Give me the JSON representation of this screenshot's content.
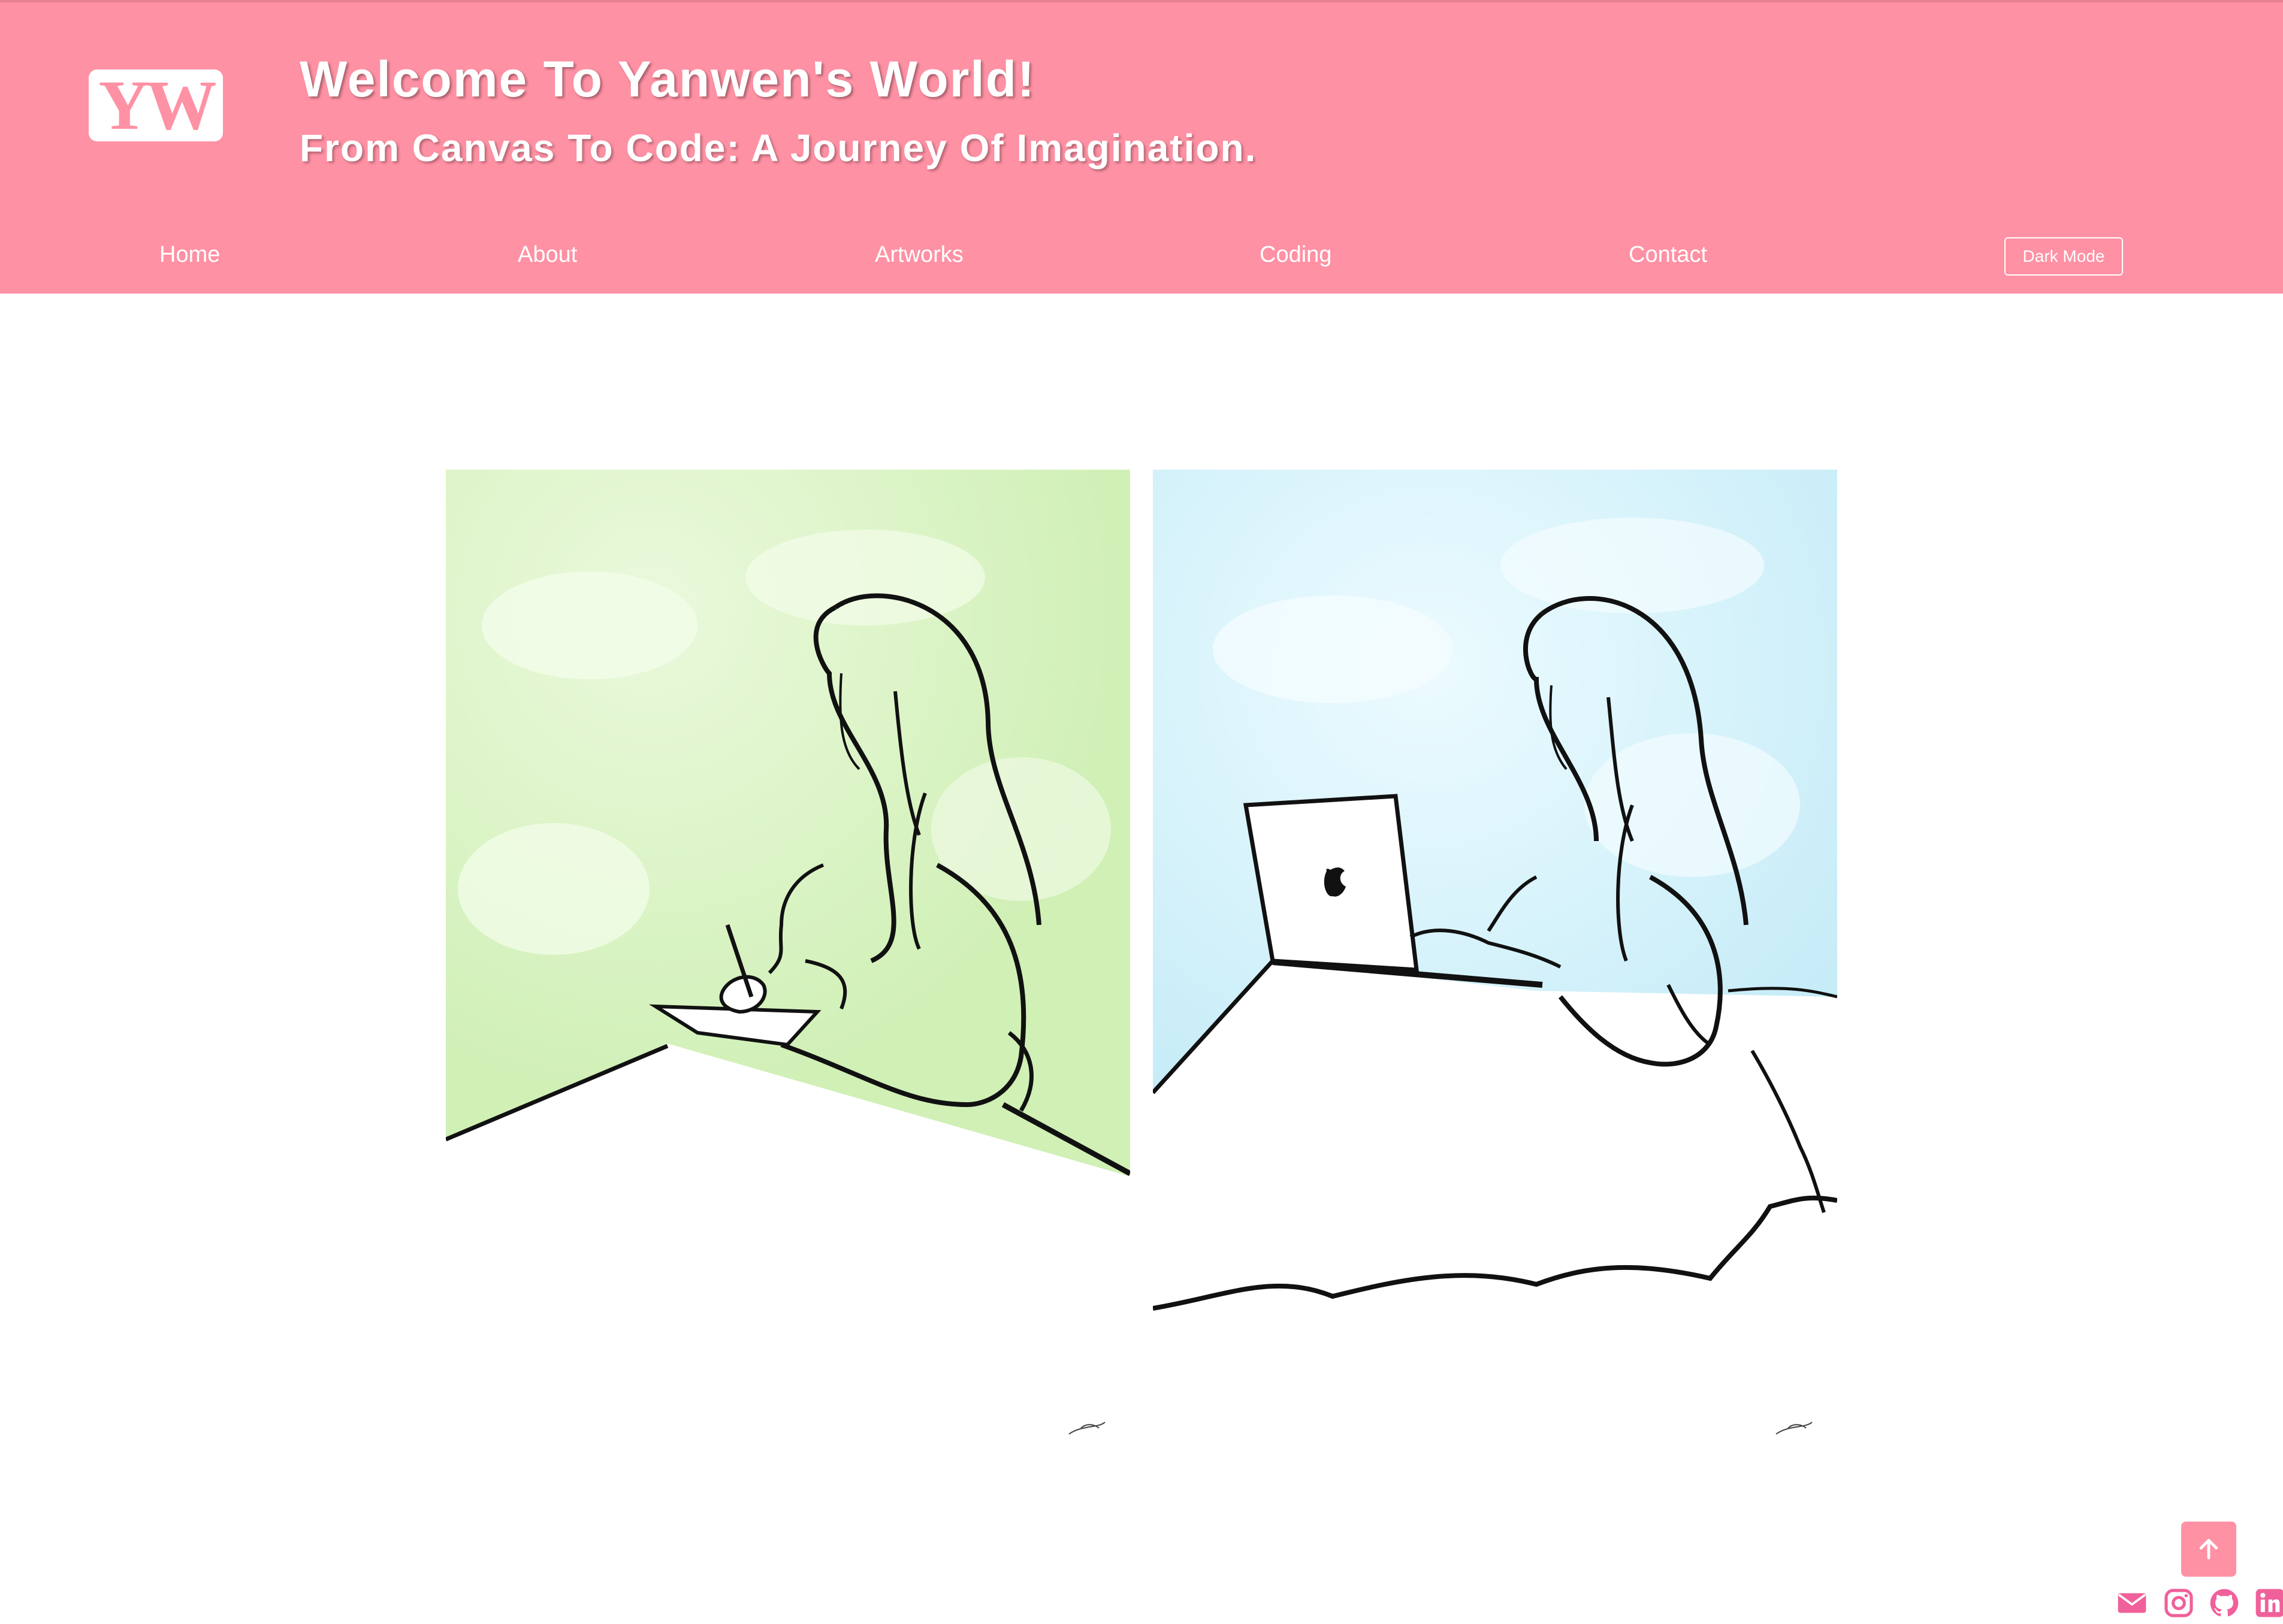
{
  "header": {
    "logo_text": "YW",
    "title": "Welcome To Yanwen's World!",
    "subtitle": "From Canvas To Code: A Journey Of Imagination."
  },
  "nav": {
    "items": [
      {
        "label": "Home"
      },
      {
        "label": "About"
      },
      {
        "label": "Artworks"
      },
      {
        "label": "Coding"
      },
      {
        "label": "Contact"
      }
    ],
    "dark_mode_label": "Dark Mode"
  },
  "artworks": [
    {
      "icon": "girl-drawing-on-tablet-illustration",
      "background": "#d8f4c4"
    },
    {
      "icon": "girl-using-laptop-illustration",
      "background": "#cdeffb"
    }
  ],
  "footer": {
    "back_to_top_icon": "arrow-up-icon",
    "social_icons": [
      "email-icon",
      "instagram-icon",
      "github-icon",
      "linkedin-icon"
    ]
  },
  "colors": {
    "accent": "#ff91a4",
    "social": "#f0609a"
  }
}
